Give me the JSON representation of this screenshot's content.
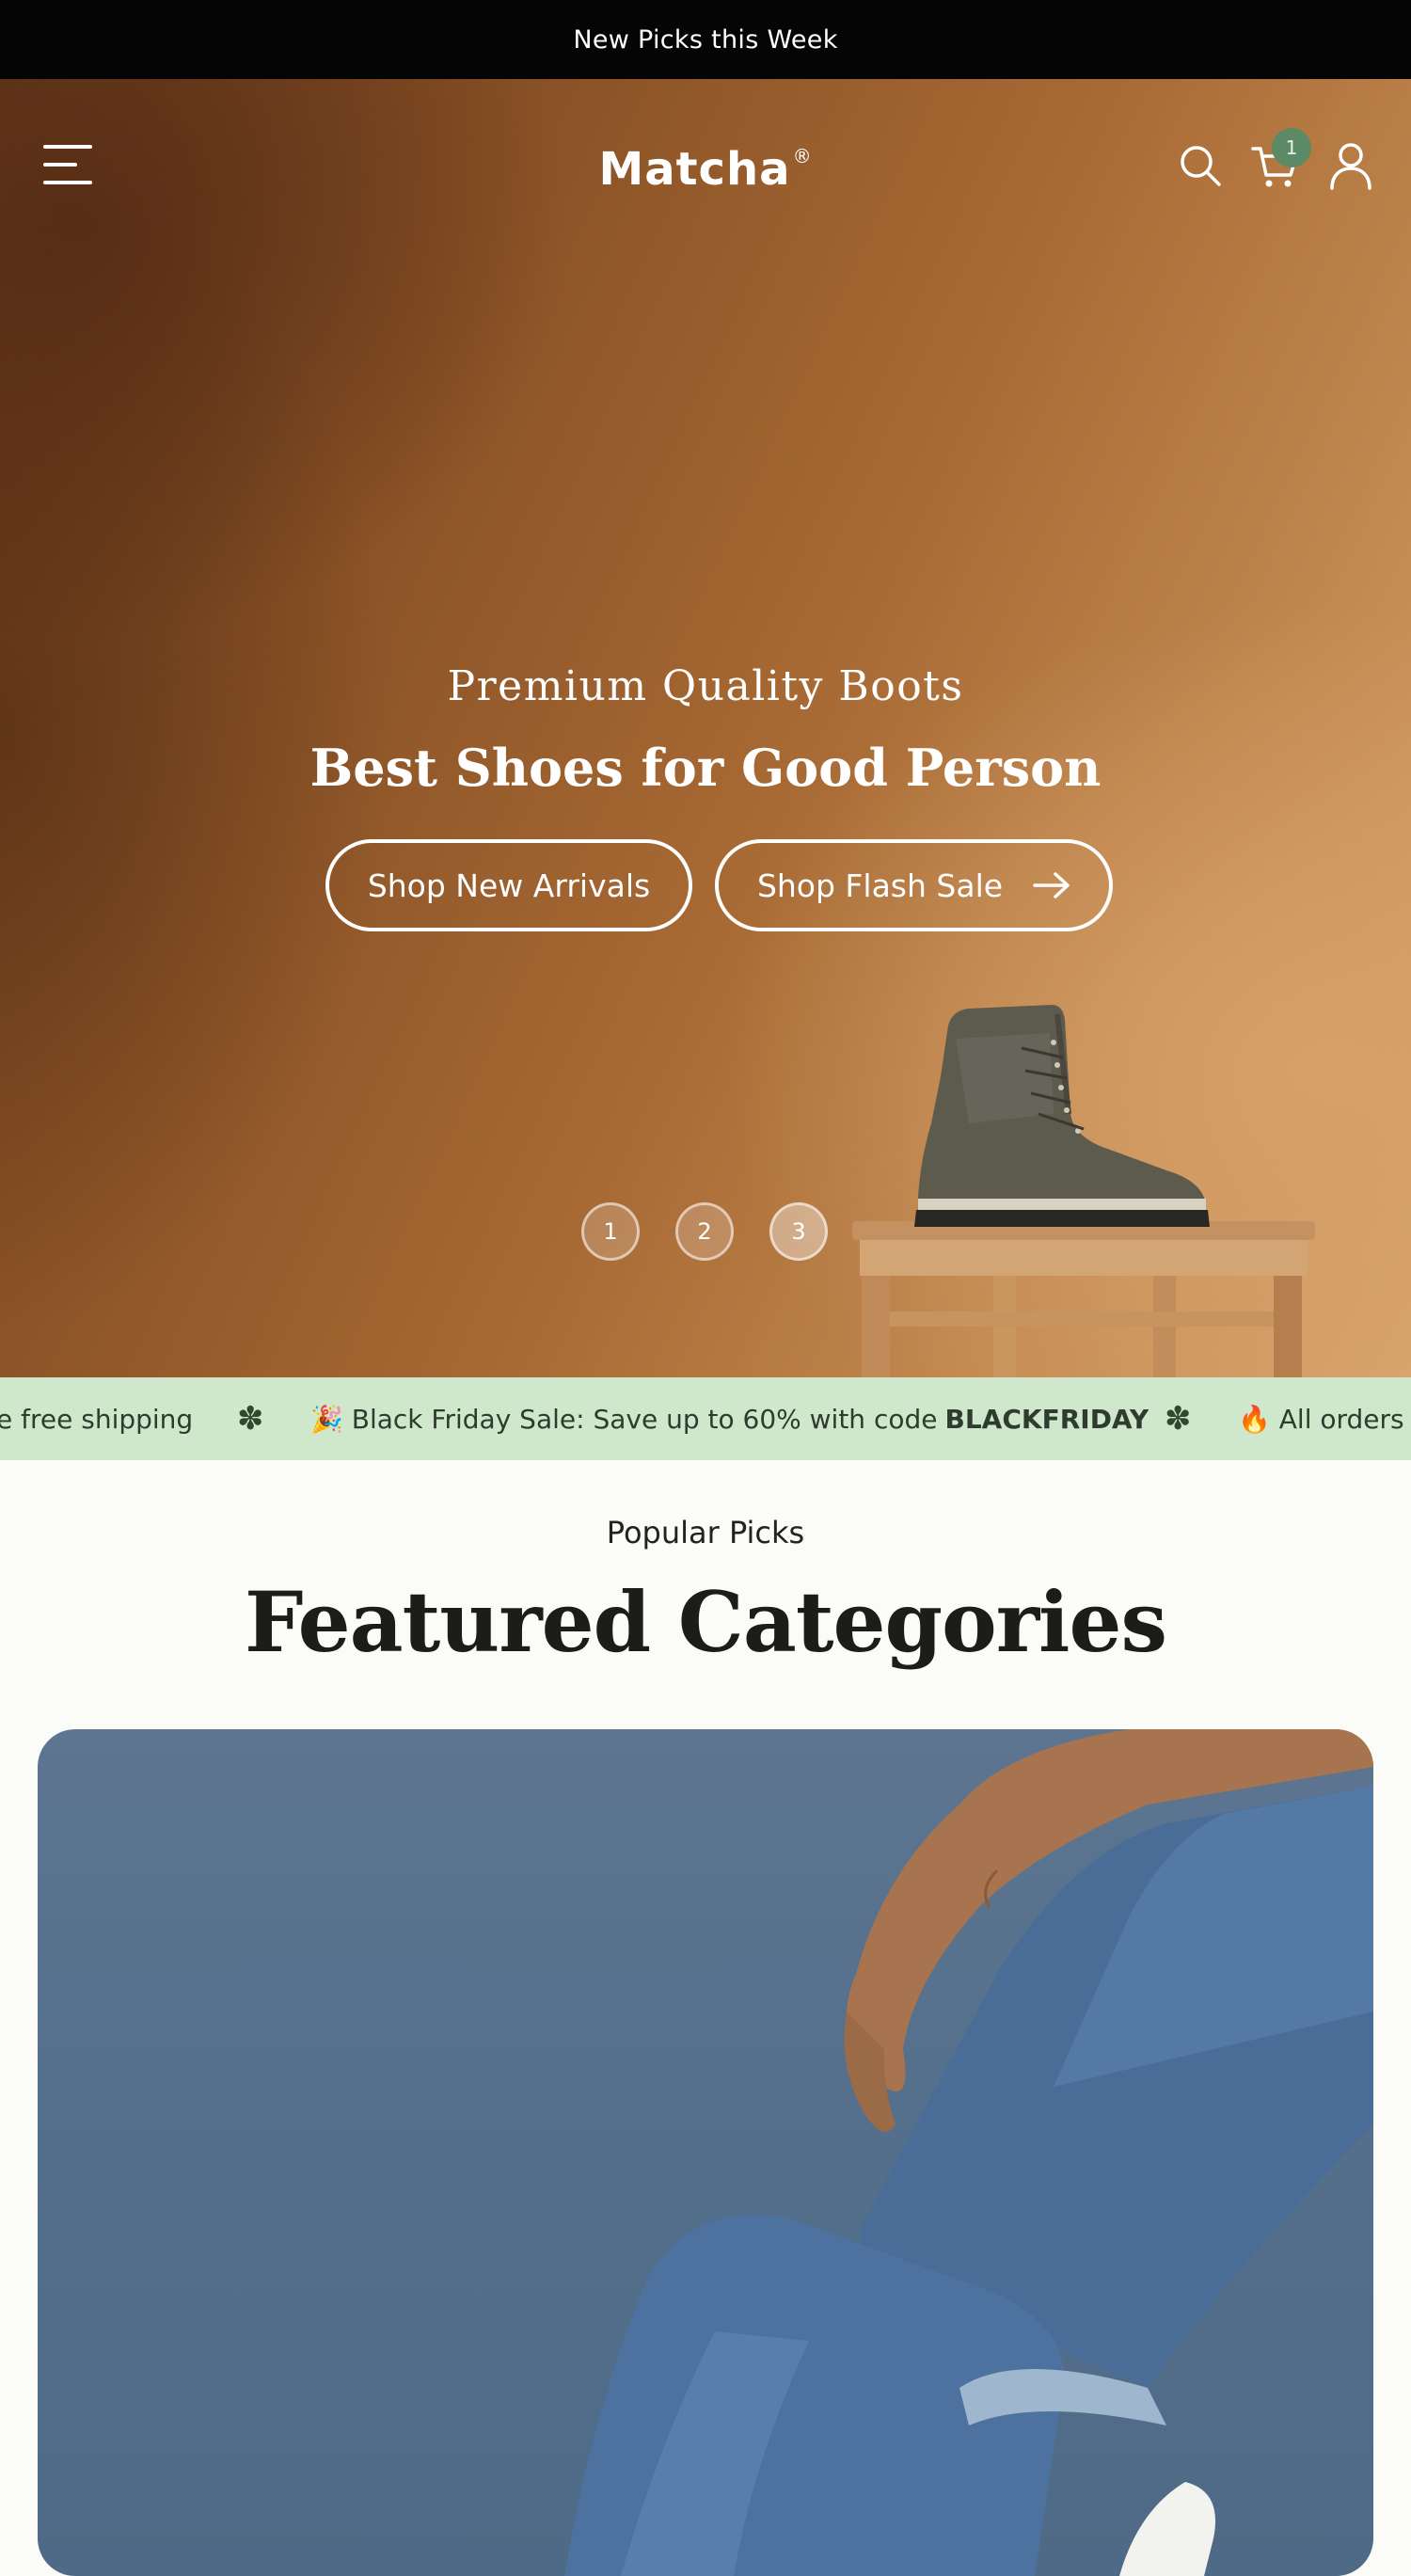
{
  "announcement": {
    "text": "New Picks this Week"
  },
  "header": {
    "logo": "Matcha",
    "logo_mark": "®",
    "cart_count": "1",
    "icons": [
      "menu-icon",
      "search-icon",
      "cart-icon",
      "account-icon"
    ]
  },
  "hero": {
    "eyebrow": "Premium Quality Boots",
    "title": "Best Shoes for Good Person",
    "buttons": {
      "new_arrivals": "Shop New Arrivals",
      "flash_sale": "Shop Flash Sale"
    },
    "slides": [
      "1",
      "2",
      "3"
    ],
    "active_slide": "3"
  },
  "marquee": {
    "items": [
      "e free shipping",
      "🎉 Black Friday Sale: Save up to 60% with code",
      "🔥 All orders r"
    ],
    "code": "BLACKFRIDAY",
    "separator": "✽"
  },
  "featured": {
    "eyebrow": "Popular Picks",
    "title": "Featured Categories"
  },
  "colors": {
    "announcement_bg": "#050505",
    "marquee_bg": "#cfe8cb",
    "badge": "#5c8a66",
    "page_bg": "#fbfbf8"
  }
}
